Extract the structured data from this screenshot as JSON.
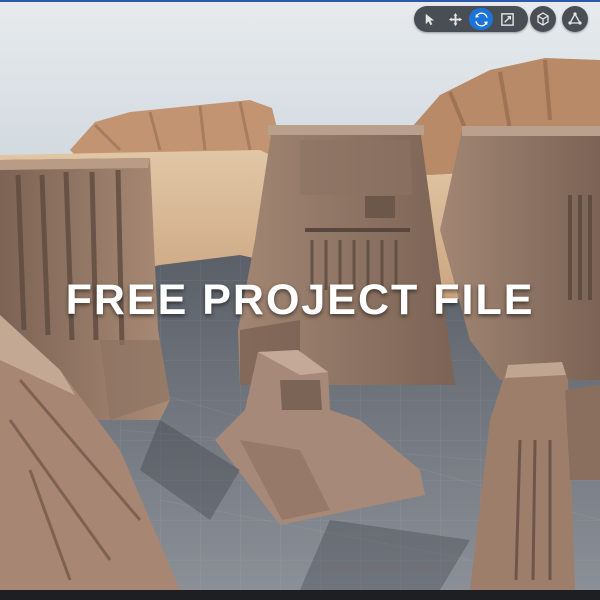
{
  "viewport": {
    "overlay_text": "FREE PROJECT FILE"
  },
  "toolbar": {
    "tools": [
      {
        "name": "select",
        "icon": "cursor-icon",
        "active": false
      },
      {
        "name": "move",
        "icon": "move-arrows-icon",
        "active": false
      },
      {
        "name": "rotate",
        "icon": "rotate-icon",
        "active": true
      },
      {
        "name": "scale",
        "icon": "scale-icon",
        "active": false
      }
    ],
    "camera_icon": "perspective-cube-icon",
    "snap_icon": "world-snap-icon",
    "active_color": "#1d74d8"
  },
  "colors": {
    "sky": "#d6dce1",
    "sand": "#cfa57e",
    "stone": "#9a7d6a",
    "floor": "#6b7078"
  }
}
